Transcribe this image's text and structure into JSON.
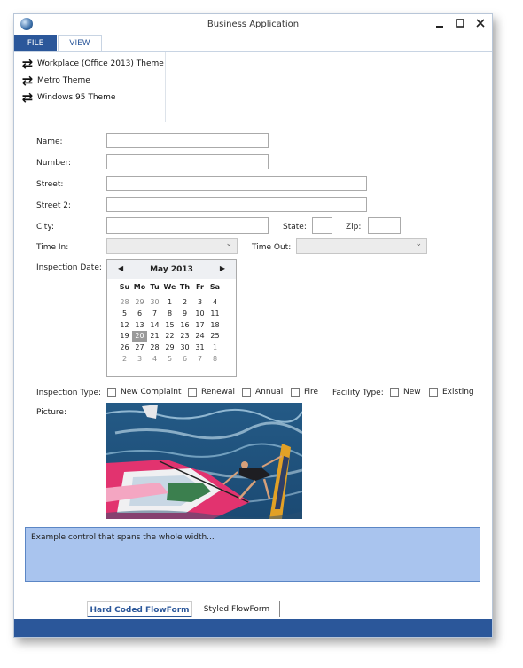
{
  "window": {
    "title": "Business Application"
  },
  "ribbon": {
    "tabs": [
      "FILE",
      "VIEW"
    ],
    "themes": [
      "Workplace (Office 2013) Theme",
      "Metro Theme",
      "Windows 95 Theme"
    ]
  },
  "form": {
    "name_label": "Name:",
    "number_label": "Number:",
    "street_label": "Street:",
    "street2_label": "Street 2:",
    "city_label": "City:",
    "state_label": "State:",
    "zip_label": "Zip:",
    "time_in_label": "Time In:",
    "time_out_label": "Time Out:",
    "inspection_date_label": "Inspection Date:",
    "inspection_type_label": "Inspection Type:",
    "inspection_types": [
      "New Complaint",
      "Renewal",
      "Annual",
      "Fire"
    ],
    "facility_type_label": "Facility Type:",
    "facility_types": [
      "New",
      "Existing"
    ],
    "picture_label": "Picture:",
    "wide_text": "Example control that spans the whole width..."
  },
  "calendar": {
    "month_label": "May 2013",
    "days_of_week": [
      "Su",
      "Mo",
      "Tu",
      "We",
      "Th",
      "Fr",
      "Sa"
    ],
    "weeks": [
      [
        "28",
        "29",
        "30",
        "1",
        "2",
        "3",
        "4"
      ],
      [
        "5",
        "6",
        "7",
        "8",
        "9",
        "10",
        "11"
      ],
      [
        "12",
        "13",
        "14",
        "15",
        "16",
        "17",
        "18"
      ],
      [
        "19",
        "20",
        "21",
        "22",
        "23",
        "24",
        "25"
      ],
      [
        "26",
        "27",
        "28",
        "29",
        "30",
        "31",
        "1"
      ],
      [
        "2",
        "3",
        "4",
        "5",
        "6",
        "7",
        "8"
      ]
    ],
    "selected": "20"
  },
  "bottom_tabs": [
    "Hard Coded FlowForm",
    "Styled FlowForm"
  ]
}
